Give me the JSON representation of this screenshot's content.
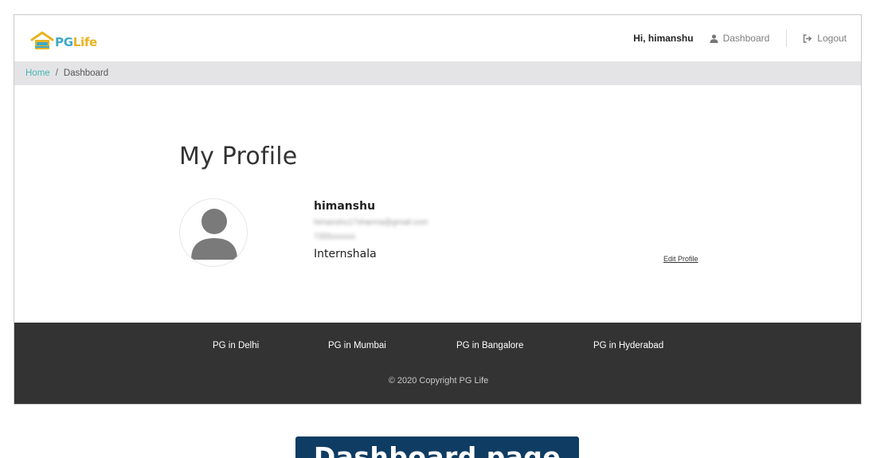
{
  "header": {
    "logo": {
      "pg": "PG",
      "life": "Life"
    },
    "greeting": "Hi, himanshu",
    "dashboard_label": "Dashboard",
    "logout_label": "Logout"
  },
  "breadcrumb": {
    "home": "Home",
    "separator": "/",
    "current": "Dashboard"
  },
  "profile": {
    "heading": "My Profile",
    "name": "himanshu",
    "email_blurred": "himanshu17sharma@gmail.com",
    "phone_blurred": "7355xxxxxx",
    "college": "Internshala",
    "edit_label": "Edit Profile"
  },
  "footer": {
    "links": [
      "PG in Delhi",
      "PG in Mumbai",
      "PG in Bangalore",
      "PG in Hyderabad"
    ],
    "copyright": "© 2020 Copyright PG Life"
  },
  "caption": "Dashboard page",
  "colors": {
    "accent_teal": "#48b6b6",
    "logo_yellow": "#e7b321",
    "footer_bg": "#333333",
    "breadcrumb_bg": "#e4e4e6",
    "caption_bg": "#0f3c63"
  },
  "icons": [
    "home-logo-icon",
    "user-icon",
    "logout-icon",
    "avatar-placeholder-icon"
  ]
}
